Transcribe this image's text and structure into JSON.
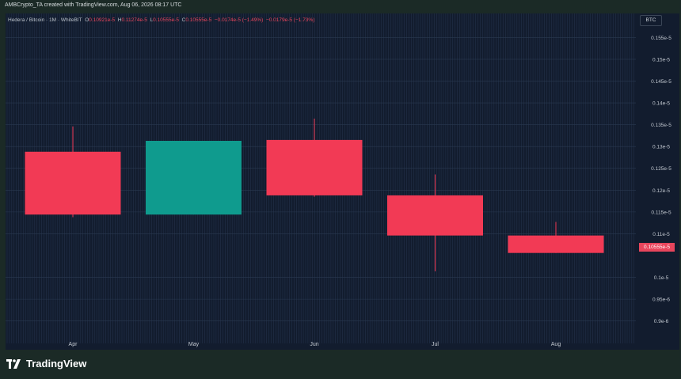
{
  "header": {
    "attribution": "AMBCrypto_TA created with TradingView.com, Aug 06, 2026 08:17 UTC"
  },
  "legend": {
    "symbol": "Hedera / Bitcoin · 1M · WhiteBIT",
    "open_label": "O",
    "open": "0.10921e-5",
    "high_label": "H",
    "high": "0.11274e-5",
    "low_label": "L",
    "low": "0.10555e-5",
    "close_label": "C",
    "close": "0.10555e-5",
    "change": "−0.0174e-5 (−1.49%)",
    "change2": "−0.0179e-5 (−1.73%)"
  },
  "currency": "BTC",
  "last_price": "0.10555e-5",
  "brand": "TradingView",
  "colors": {
    "up": "#0f9b8e",
    "down": "#f23a55",
    "background": "#121c2e",
    "outer": "#1b2a26"
  },
  "chart_data": {
    "type": "candlestick",
    "categories": [
      "Apr",
      "May",
      "Jun",
      "Jul",
      "Aug"
    ],
    "series": [
      {
        "open": 0.1288,
        "high": 0.1346,
        "low": 0.1138,
        "close": 0.1144
      },
      {
        "open": 0.1144,
        "high": 0.131,
        "low": 0.1144,
        "close": 0.1313
      },
      {
        "open": 0.1315,
        "high": 0.1364,
        "low": 0.1185,
        "close": 0.1188
      },
      {
        "open": 0.1188,
        "high": 0.1236,
        "low": 0.1014,
        "close": 0.1096
      },
      {
        "open": 0.1096,
        "high": 0.1127,
        "low": 0.1056,
        "close": 0.1056
      }
    ],
    "y_ticks": [
      "0.155e-5",
      "0.15e-5",
      "0.145e-5",
      "0.14e-5",
      "0.135e-5",
      "0.13e-5",
      "0.125e-5",
      "0.12e-5",
      "0.115e-5",
      "0.11e-5",
      "0.1e-5",
      "0.95e-6",
      "0.9e-6"
    ],
    "y_tick_values": [
      0.155,
      0.15,
      0.145,
      0.14,
      0.135,
      0.13,
      0.125,
      0.12,
      0.115,
      0.11,
      0.1,
      0.095,
      0.09
    ],
    "ylim": [
      0.0865,
      0.1605
    ],
    "grid": true
  }
}
